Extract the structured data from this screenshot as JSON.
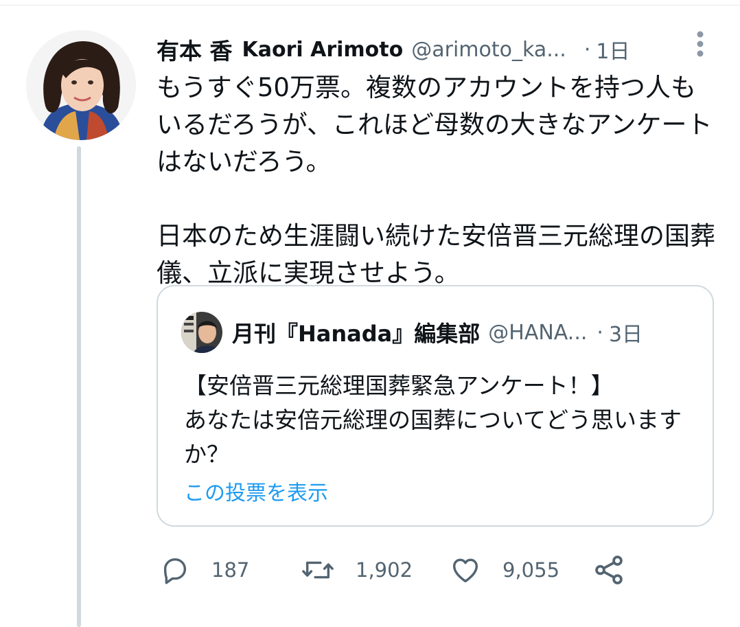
{
  "tweet": {
    "author_name_ja": "有本 香",
    "author_name_en": "Kaori Arimoto",
    "handle": "@arimoto_ka...",
    "separator": "·",
    "time": "1日",
    "text": "もうすぐ50万票。複数のアカウントを持つ人もいるだろうが、これほど母数の大きなアンケートはないだろう。\n\n日本のため生涯闘い続けた安倍晋三元総理の国葬儀、立派に実現させよう。"
  },
  "quoted_tweet": {
    "author_name": "月刊『Hanada』編集部",
    "handle": "@HANA...",
    "separator": "·",
    "time": "3日",
    "text": "【安倍晋三元総理国葬緊急アンケート！】\nあなたは安倍元総理の国葬についてどう思いますか？",
    "poll_link": "この投票を表示"
  },
  "actions": {
    "reply_count": "187",
    "retweet_count": "1,902",
    "like_count": "9,055"
  },
  "icons": {
    "more": "more-vertical-icon",
    "reply": "reply-icon",
    "retweet": "retweet-icon",
    "like": "heart-icon",
    "share": "share-icon"
  },
  "colors": {
    "text": "#0f1419",
    "secondary": "#536471",
    "link": "#1d9bf0",
    "border": "#cfd9de"
  }
}
